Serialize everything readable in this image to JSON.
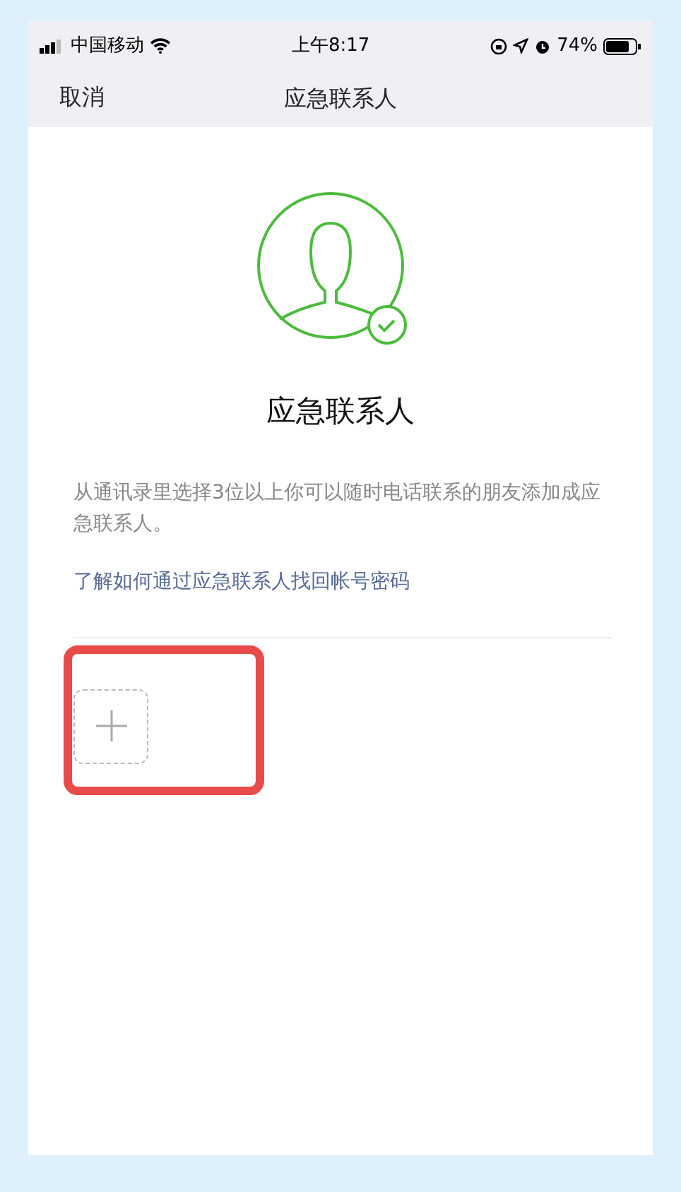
{
  "status_bar": {
    "carrier": "中国移动",
    "time": "上午8:17",
    "battery": "74%"
  },
  "nav": {
    "cancel": "取消",
    "title": "应急联系人"
  },
  "heading": "应急联系人",
  "description": "从通讯录里选择3位以上你可以随时电话联系的朋友添加成应急联系人。",
  "help_link": "了解如何通过应急联系人找回帐号密码"
}
